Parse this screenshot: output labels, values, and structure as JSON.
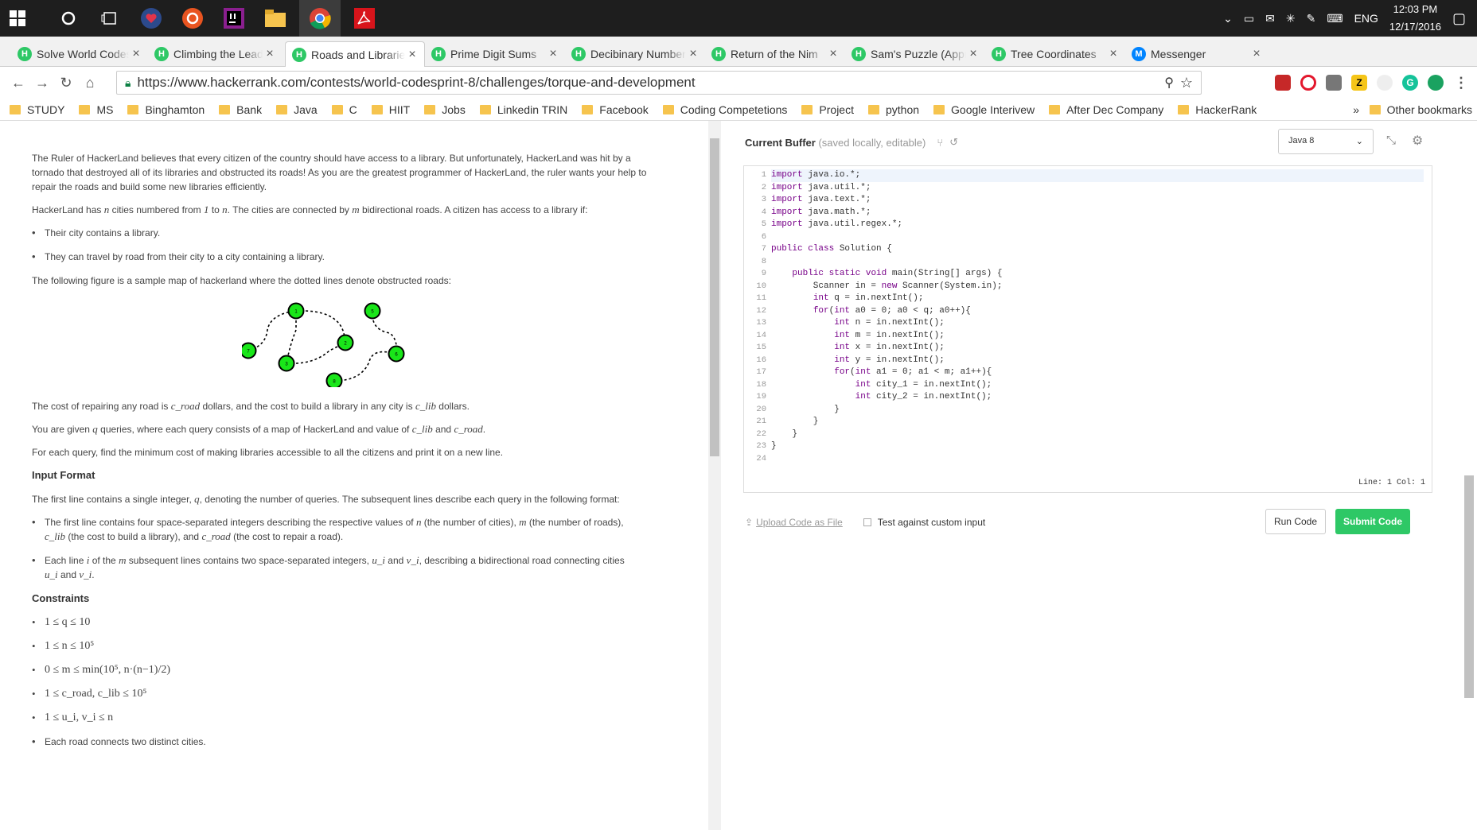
{
  "taskbar": {
    "tray": {
      "lang": "ENG",
      "time": "12:03 PM",
      "date": "12/17/2016"
    }
  },
  "tabs": [
    {
      "title": "Solve World Codesprint",
      "favicon": "H"
    },
    {
      "title": "Climbing the Leaderboard",
      "favicon": "H"
    },
    {
      "title": "Roads and Libraries",
      "favicon": "H",
      "active": true
    },
    {
      "title": "Prime Digit Sums",
      "favicon": "H"
    },
    {
      "title": "Decibinary Numbers",
      "favicon": "H"
    },
    {
      "title": "Return of the Nim",
      "favicon": "H"
    },
    {
      "title": "Sam's Puzzle (Approximate)",
      "favicon": "H"
    },
    {
      "title": "Tree Coordinates",
      "favicon": "H"
    },
    {
      "title": "Messenger",
      "favicon": "M"
    }
  ],
  "address": {
    "url": "https://www.hackerrank.com/contests/world-codesprint-8/challenges/torque-and-development"
  },
  "bookmarks": [
    "STUDY",
    "MS",
    "Binghamton",
    "Bank",
    "Java",
    "C",
    "HIIT",
    "Jobs",
    "Linkedin TRIN",
    "Facebook",
    "Coding Competetions",
    "Project",
    "python",
    "Google Interivew",
    "After Dec Company",
    "HackerRank"
  ],
  "other_bookmarks": "Other bookmarks",
  "problem": {
    "p1": "The Ruler of HackerLand believes that every citizen of the country should have access to a library. But unfortunately, HackerLand was hit by a tornado that destroyed all of its libraries and obstructed its roads! As you are the greatest programmer of HackerLand, the ruler wants your help to repair the roads and build some new libraries efficiently.",
    "p2a": "HackerLand has",
    "p2b": "cities numbered from",
    "p2c": "to",
    "p2d": ". The cities are connected by",
    "p2e": "bidirectional roads. A citizen has access to a library if:",
    "bullet1": "Their city contains a library.",
    "bullet2": "They can travel by road from their city to a city containing a library.",
    "p3": "The following figure is a sample map of hackerland where the dotted lines denote obstructed roads:",
    "p4a": "The cost of repairing any road is",
    "p4b": "dollars, and the cost to build a library in any city is",
    "p4c": "dollars.",
    "p5a": "You are given",
    "p5b": "queries, where each query consists of a map of HackerLand and value of",
    "p5c": "and",
    "p6": "For each query, find the minimum cost of making libraries accessible to all the citizens and print it on a new line.",
    "input_heading": "Input Format",
    "p7a": "The first line contains a single integer,",
    "p7b": ", denoting the number of queries. The subsequent lines describe each query in the following format:",
    "in1a": "The first line contains four space-separated integers describing the respective values of",
    "in1b": "(the number of cities),",
    "in1c": "(the number of roads),",
    "in1d": "(the cost to build a library), and",
    "in1e": "(the cost to repair a road).",
    "in2a": "Each line",
    "in2b": "of the",
    "in2c": "subsequent lines contains two space-separated integers,",
    "in2d": "and",
    "in2e": ", describing a bidirectional road connecting cities",
    "in2f": "and",
    "constraints_heading": "Constraints",
    "constraints": [
      "1 ≤ q ≤ 10",
      "1 ≤ n ≤ 10⁵",
      "0 ≤ m ≤ min(10⁵, n·(n−1)/2)",
      "1 ≤ c_road, c_lib ≤ 10⁵",
      "1 ≤ u_i, v_i ≤ n",
      "Each road connects two distinct cities."
    ],
    "math": {
      "n": "n",
      "one": "1",
      "m": "m",
      "q": "q",
      "croad": "c_road",
      "clib": "c_lib",
      "i": "i",
      "ui": "u_i",
      "vi": "v_i"
    }
  },
  "graph_nodes": [
    "1",
    "5",
    "7",
    "2",
    "3",
    "6",
    "8"
  ],
  "editor": {
    "buffer_title": "Current Buffer",
    "buffer_sub": "(saved locally, editable)",
    "language": "Java 8",
    "linecol": "Line: 1 Col: 1",
    "lines": [
      "import java.io.*;",
      "import java.util.*;",
      "import java.text.*;",
      "import java.math.*;",
      "import java.util.regex.*;",
      "",
      "public class Solution {",
      "",
      "    public static void main(String[] args) {",
      "        Scanner in = new Scanner(System.in);",
      "        int q = in.nextInt();",
      "        for(int a0 = 0; a0 < q; a0++){",
      "            int n = in.nextInt();",
      "            int m = in.nextInt();",
      "            int x = in.nextInt();",
      "            int y = in.nextInt();",
      "            for(int a1 = 0; a1 < m; a1++){",
      "                int city_1 = in.nextInt();",
      "                int city_2 = in.nextInt();",
      "            }",
      "        }",
      "    }",
      "}",
      ""
    ],
    "upload": "Upload Code as File",
    "custom_input": "Test against custom input",
    "run": "Run Code",
    "submit": "Submit Code"
  }
}
